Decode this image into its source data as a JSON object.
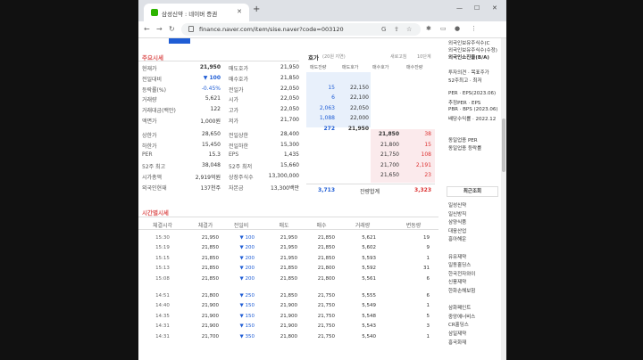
{
  "browser": {
    "tab_title": "삼성신약 : 네이버 증권",
    "url": "finance.naver.com/item/sise.naver?code=003120"
  },
  "main_title": "주요시세",
  "quote": {
    "left": [
      {
        "label": "현재가",
        "value": "21,950",
        "cls": "bold"
      },
      {
        "label": "전일대비",
        "value": "▼ 100",
        "cls": "blue bold"
      },
      {
        "label": "등락률(%)",
        "value": "-0.45%",
        "cls": "blue"
      },
      {
        "label": "거래량",
        "value": "5,621",
        "cls": ""
      },
      {
        "label": "거래대금(백만)",
        "value": "122",
        "cls": ""
      },
      {
        "label": "액면가",
        "value": "1,000원",
        "cls": ""
      },
      {
        "label": "상한가",
        "value": "28,650",
        "cls": ""
      },
      {
        "label": "하한가",
        "value": "15,450",
        "cls": ""
      },
      {
        "label": "PER",
        "value": "15.3",
        "cls": ""
      },
      {
        "label": "52주 최고",
        "value": "38,048",
        "cls": ""
      },
      {
        "label": "시가총액",
        "value": "2,919억원",
        "cls": ""
      },
      {
        "label": "외국인현재",
        "value": "137천주",
        "cls": ""
      }
    ],
    "right": [
      {
        "label": "매도호가",
        "value": "21,950"
      },
      {
        "label": "매수호가",
        "value": "21,850"
      },
      {
        "label": "전일가",
        "value": "22,050"
      },
      {
        "label": "시가",
        "value": "22,050"
      },
      {
        "label": "고가",
        "value": "22,050"
      },
      {
        "label": "저가",
        "value": "21,700"
      },
      {
        "label": "전일상한",
        "value": "28,400"
      },
      {
        "label": "전일하한",
        "value": "15,300"
      },
      {
        "label": "EPS",
        "value": "1,435"
      },
      {
        "label": "52주 최저",
        "value": "15,660"
      },
      {
        "label": "상장주식수",
        "value": "13,300,000"
      },
      {
        "label": "자본금",
        "value": "13,300백만"
      }
    ]
  },
  "orderbook": {
    "title": "호가",
    "subtitle": "(20원 지연)",
    "refresh": "새로고침",
    "depth": "10단계",
    "headers": [
      "매도잔량",
      "매도호가",
      "매수호가",
      "매수잔량"
    ],
    "sell": [
      {
        "qty": "",
        "price": ""
      },
      {
        "qty": "15",
        "price": "22,150"
      },
      {
        "qty": "6",
        "price": "22,100"
      },
      {
        "qty": "2,063",
        "price": "22,050"
      },
      {
        "qty": "1,088",
        "price": "22,000"
      },
      {
        "qty": "272",
        "price": "21,950"
      }
    ],
    "buy": [
      {
        "price": "21,850",
        "qty": "38"
      },
      {
        "price": "21,800",
        "qty": "15"
      },
      {
        "price": "21,750",
        "qty": "108"
      },
      {
        "price": "21,700",
        "qty": "2,191"
      },
      {
        "price": "21,650",
        "qty": "23"
      }
    ],
    "total_sell": "3,713",
    "total_label": "잔량합계",
    "total_buy": "3,323"
  },
  "timeseries": {
    "title": "시간별시세",
    "headers": [
      "체결시각",
      "체결가",
      "전일비",
      "매도",
      "매수",
      "거래량",
      "변동량"
    ],
    "rows": [
      [
        "15:30",
        "21,950",
        "▼ 100",
        "21,950",
        "21,850",
        "5,621",
        "19"
      ],
      [
        "15:19",
        "21,850",
        "▼ 200",
        "21,950",
        "21,850",
        "5,602",
        "9"
      ],
      [
        "15:15",
        "21,850",
        "▼ 200",
        "21,950",
        "21,850",
        "5,593",
        "1"
      ],
      [
        "15:13",
        "21,850",
        "▼ 200",
        "21,850",
        "21,800",
        "5,592",
        "31"
      ],
      [
        "15:08",
        "21,850",
        "▼ 200",
        "21,850",
        "21,800",
        "5,561",
        "6"
      ],
      [
        "14:51",
        "21,800",
        "▼ 250",
        "21,850",
        "21,750",
        "5,555",
        "6"
      ],
      [
        "14:40",
        "21,900",
        "▼ 150",
        "21,900",
        "21,750",
        "5,549",
        "1"
      ],
      [
        "14:35",
        "21,900",
        "▼ 150",
        "21,900",
        "21,750",
        "5,548",
        "5"
      ],
      [
        "14:31",
        "21,900",
        "▼ 150",
        "21,900",
        "21,750",
        "5,543",
        "3"
      ],
      [
        "14:31",
        "21,700",
        "▼ 350",
        "21,800",
        "21,750",
        "5,540",
        "1"
      ]
    ]
  },
  "right_panel": {
    "top_items": [
      "외국인보유주식수(C",
      "외국인보유주식수(수정)",
      "외국인소진율(B/A)"
    ],
    "opinion": [
      "투자의견 · 목표주가",
      "52주최고 · 최저"
    ],
    "metrics": [
      "PER · EPS(2023.06)",
      "추정PER · EPS",
      "PBR · BPS (2023.06)",
      "배당수익률 · 2022.12"
    ],
    "industry": [
      "동일업종 PER",
      "동일업종 등락률"
    ],
    "recent_title": "최근조회",
    "recent": [
      "일성신약",
      "일신방직",
      "삼양식품",
      "대웅산업",
      "흥아해운",
      "",
      "유유제약",
      "일동홀딩스",
      "한국전자와이",
      "신풍제약",
      "한화손해보험",
      "",
      "삼화페인트",
      "중앙에너비스",
      "CR홀딩스",
      "삼일제약",
      "흥국화재"
    ]
  }
}
